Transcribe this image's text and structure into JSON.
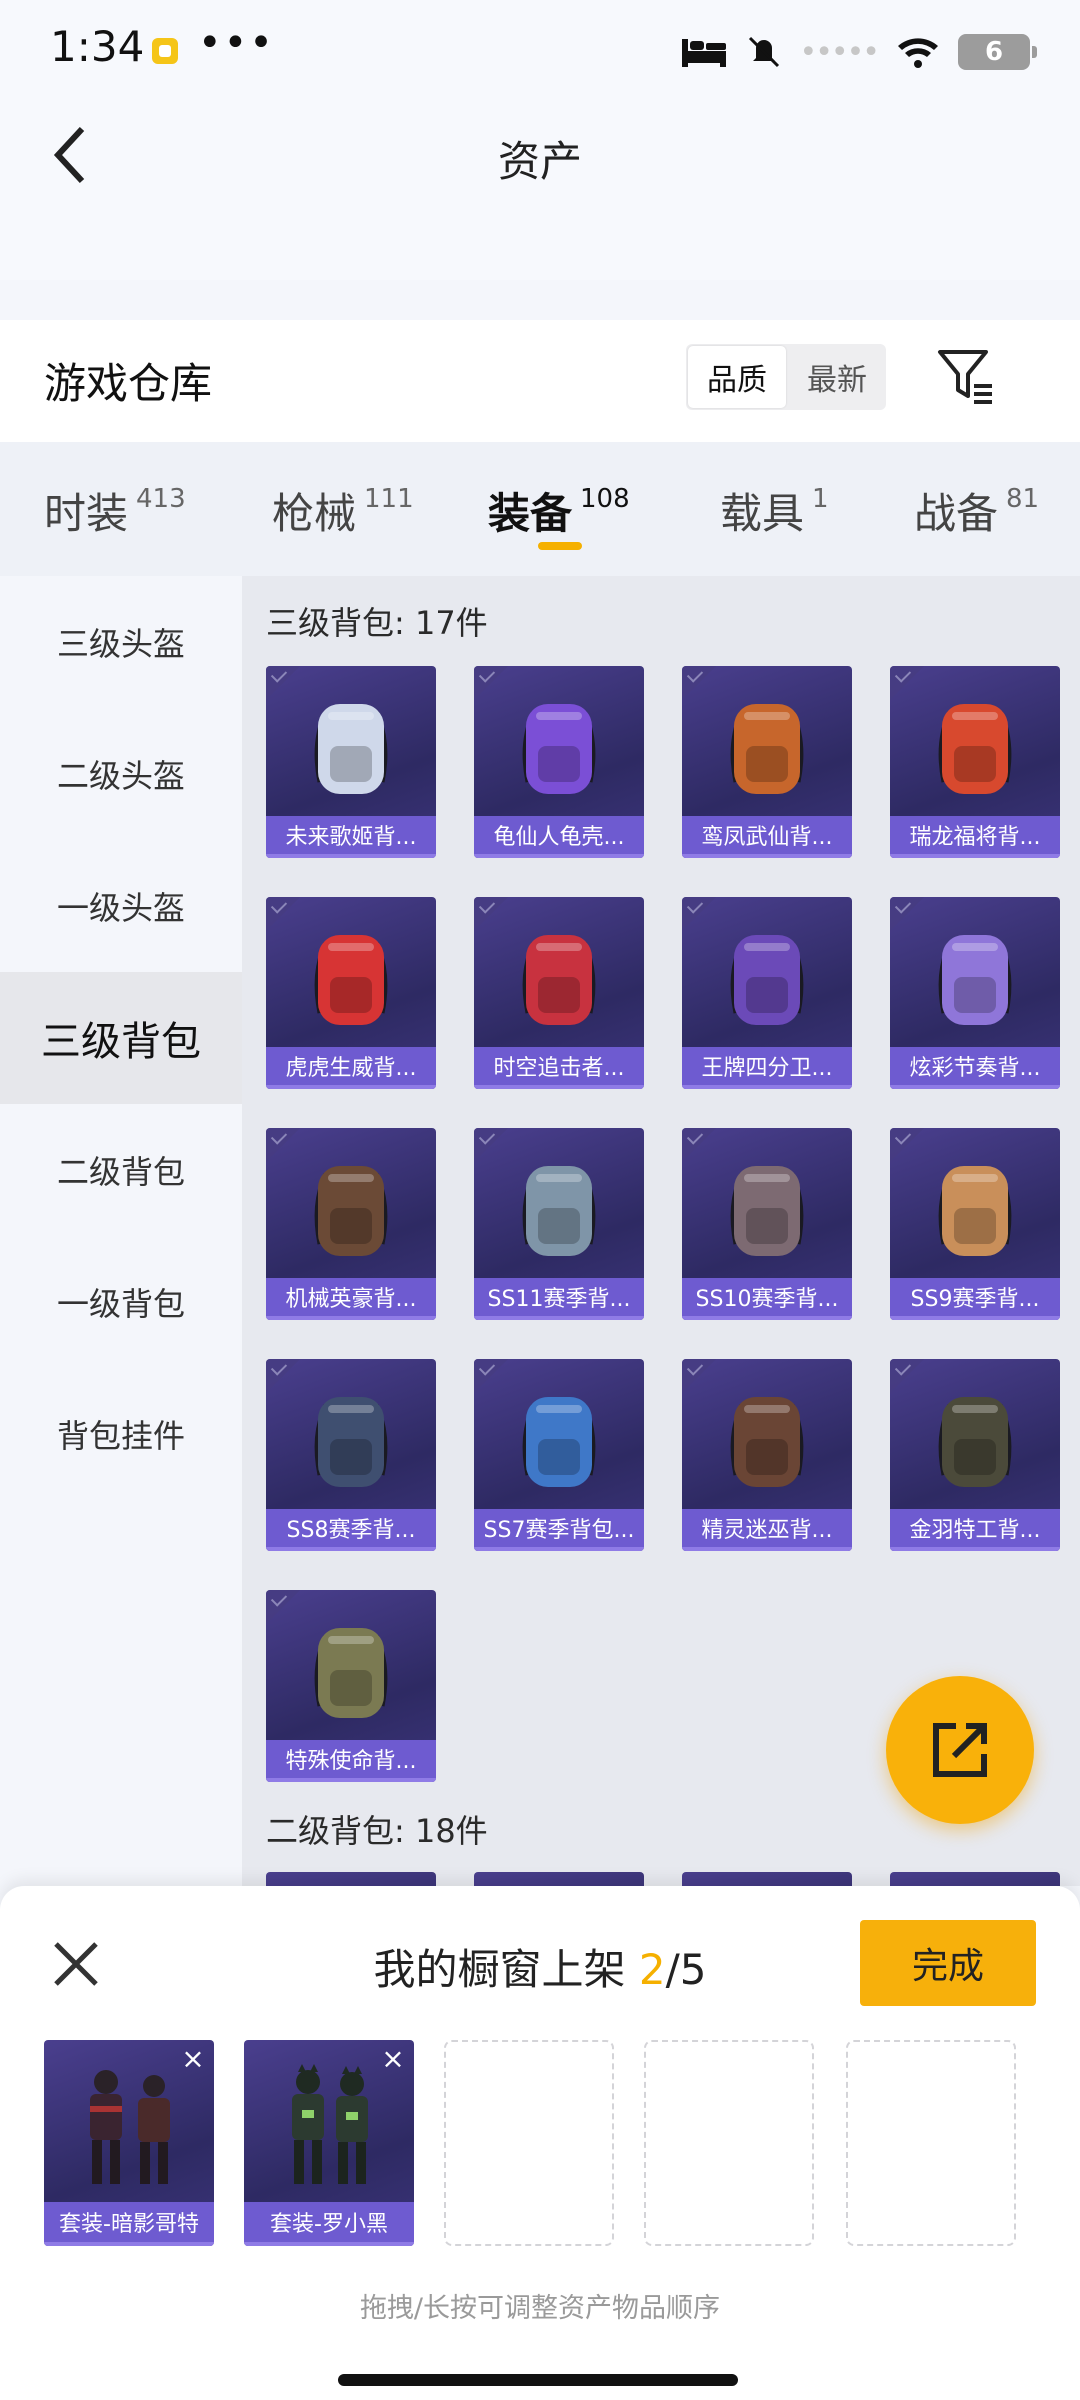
{
  "status_bar": {
    "time": "1:34",
    "dots": "•••",
    "battery": "6",
    "signal_dots": "•••••"
  },
  "header": {
    "title": "资产"
  },
  "warehouse": {
    "title": "游戏仓库",
    "sort_options": [
      "品质",
      "最新"
    ],
    "sort_selected": "品质"
  },
  "categories": [
    {
      "name": "时装",
      "count": "413"
    },
    {
      "name": "枪械",
      "count": "111"
    },
    {
      "name": "装备",
      "count": "108",
      "active": true
    },
    {
      "name": "载具",
      "count": "1"
    },
    {
      "name": "战备",
      "count": "81"
    }
  ],
  "sidebar": {
    "items": [
      "三级头盔",
      "二级头盔",
      "一级头盔",
      "三级背包",
      "二级背包",
      "一级背包",
      "背包挂件"
    ],
    "active": "三级背包"
  },
  "sections": [
    {
      "title": "三级背包: 17件",
      "items": [
        {
          "label": "未来歌姬背...",
          "color": "#cfd8ea"
        },
        {
          "label": "龟仙人龟壳...",
          "color": "#7b4fd6"
        },
        {
          "label": "鸾凤武仙背...",
          "color": "#c7662c"
        },
        {
          "label": "瑞龙福将背...",
          "color": "#d8492e"
        },
        {
          "label": "虎虎生威背...",
          "color": "#d73434"
        },
        {
          "label": "时空追击者...",
          "color": "#c8323f"
        },
        {
          "label": "王牌四分卫...",
          "color": "#6b4ab8"
        },
        {
          "label": "炫彩节奏背...",
          "color": "#8f76d9"
        },
        {
          "label": "机械英豪背...",
          "color": "#6b4a36"
        },
        {
          "label": "SS11赛季背...",
          "color": "#7f95a8"
        },
        {
          "label": "SS10赛季背...",
          "color": "#7d6a72"
        },
        {
          "label": "SS9赛季背...",
          "color": "#c98f5a"
        },
        {
          "label": "SS8赛季背...",
          "color": "#3f4f70"
        },
        {
          "label": "SS7赛季背包...",
          "color": "#3f78c8"
        },
        {
          "label": "精灵迷巫背...",
          "color": "#6a4535"
        },
        {
          "label": "金羽特工背...",
          "color": "#4b4a3a"
        },
        {
          "label": "特殊使命背...",
          "color": "#7b7a52"
        }
      ]
    },
    {
      "title": "二级背包: 18件"
    }
  ],
  "showcase": {
    "title": "我的橱窗上架 ",
    "current": "2",
    "total": "/5",
    "done_label": "完成",
    "slots": [
      {
        "label": "套装-暗影哥特",
        "filled": true
      },
      {
        "label": "套装-罗小黑",
        "filled": true
      },
      {
        "filled": false
      },
      {
        "filled": false
      },
      {
        "filled": false
      }
    ],
    "hint": "拖拽/长按可调整资产物品顺序"
  },
  "colors": {
    "accent": "#f5b000",
    "label_bg": "#6e5bd0",
    "card_bg": "#3a337a"
  }
}
